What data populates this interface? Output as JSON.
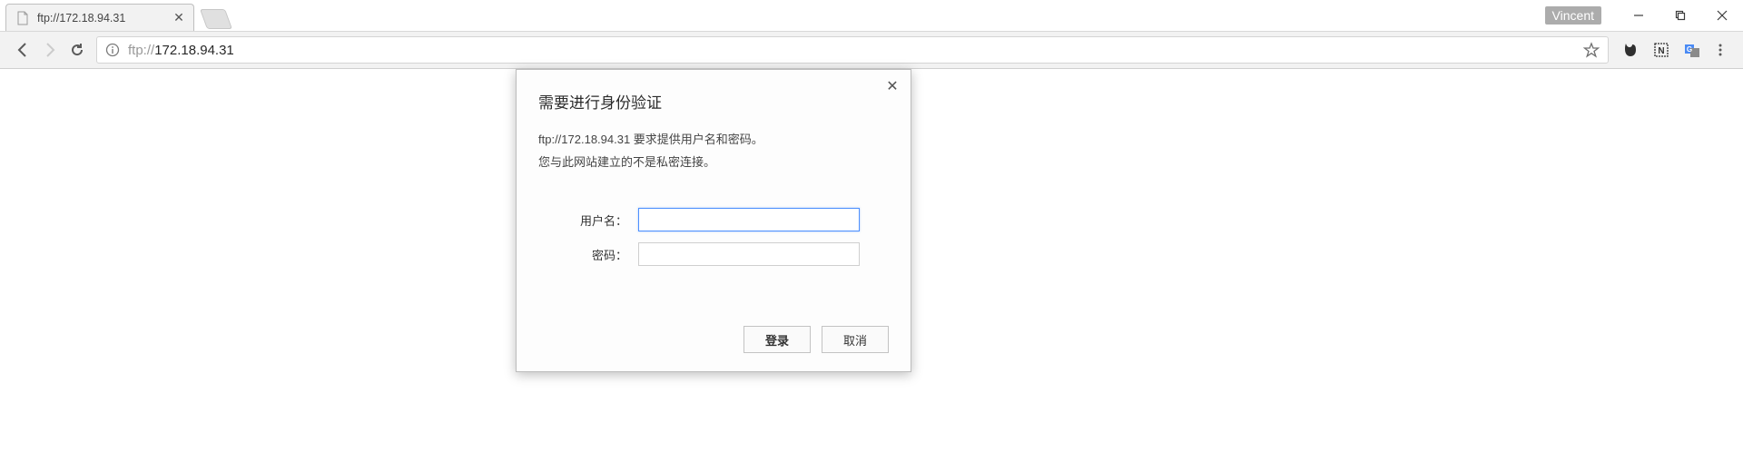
{
  "window": {
    "user_badge": "Vincent"
  },
  "tab": {
    "title": "ftp://172.18.94.31"
  },
  "omnibox": {
    "protocol": "ftp://",
    "host": "172.18.94.31"
  },
  "dialog": {
    "title": "需要进行身份验证",
    "line1": "ftp://172.18.94.31 要求提供用户名和密码。",
    "line2": "您与此网站建立的不是私密连接。",
    "username_label": "用户名：",
    "password_label": "密码：",
    "username_value": "",
    "password_value": "",
    "login_label": "登录",
    "cancel_label": "取消"
  }
}
